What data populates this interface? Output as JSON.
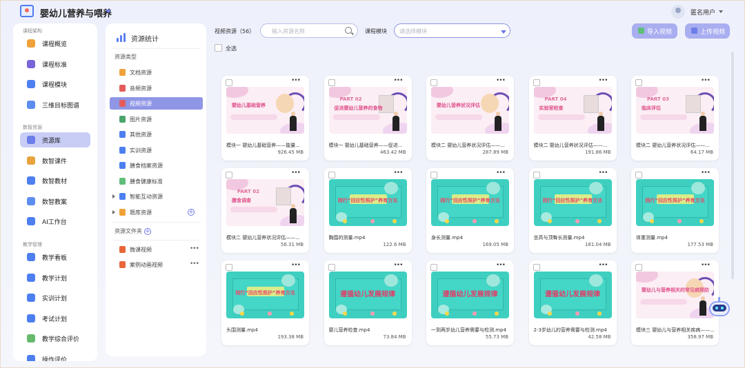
{
  "app": {
    "title": "婴幼儿营养与喂养"
  },
  "user": {
    "name": "匿名用户"
  },
  "nav": {
    "sections": [
      {
        "title": "课程架构",
        "items": [
          "课程概览",
          "课程标准",
          "课程模块",
          "三维目标图谱"
        ]
      },
      {
        "title": "数智资源",
        "items": [
          "资源库",
          "数智课件",
          "数智教材",
          "数智教案",
          "AI工作台"
        ]
      },
      {
        "title": "教学管理",
        "items": [
          "教学看板",
          "教学计划",
          "实训计划",
          "考试计划",
          "教学综合评价",
          "操作评价"
        ]
      }
    ],
    "active": "资源库"
  },
  "resource_panel": {
    "title": "资源统计",
    "type_label": "资源类型",
    "types": [
      "文档资源",
      "音频资源",
      "视频资源",
      "图片资源",
      "其他资源",
      "实训资源",
      "膳食档案资源",
      "膳食健康标准",
      "智能互动资源",
      "题库资源"
    ],
    "active": "视频资源",
    "folder_label": "资源文件夹",
    "folders": [
      "微课视频",
      "案例动画视频"
    ]
  },
  "toolbar": {
    "video_label": "视频资源（56）",
    "search_placeholder": "输入资源名称",
    "module_label": "课程模块",
    "module_placeholder": "请选择模块",
    "import_button": "导入视频",
    "upload_button": "上传视频",
    "select_all": "全选"
  },
  "videos": [
    {
      "name": "模块一 婴幼儿基础营养——能量...",
      "size": "926.45 MB",
      "thumb": "pink",
      "title": "婴幼儿基础营养",
      "part": ""
    },
    {
      "name": "模块一 婴幼儿基础营养——促进...",
      "size": "463.42 MB",
      "thumb": "pink",
      "title": "促进婴幼儿营养的食物",
      "part": "PART 02"
    },
    {
      "name": "模块二 婴幼儿营养状况评估——...",
      "size": "287.89 MB",
      "thumb": "pink",
      "title": "婴幼儿营养状况评估",
      "part": ""
    },
    {
      "name": "模块二 婴幼儿营养状况评估——...",
      "size": "191.86 MB",
      "thumb": "pink",
      "title": "实验室检查",
      "part": "PART 04"
    },
    {
      "name": "模块二 婴幼儿营养状况评估——...",
      "size": "64.17 MB",
      "thumb": "pink",
      "title": "临床评估",
      "part": "PART 03"
    },
    {
      "name": "模块二 婴幼儿营养状况评估——...",
      "size": "56.31 MB",
      "thumb": "pink",
      "title": "膳食调查",
      "part": "PART 02"
    },
    {
      "name": "胸围的测量.mp4",
      "size": "122.6 MB",
      "thumb": "teal",
      "title": "践行“回应性照护”养育方法"
    },
    {
      "name": "身长测量.mp4",
      "size": "169.05 MB",
      "thumb": "teal",
      "title": "践行“回应性照护”养育方法"
    },
    {
      "name": "坐高与顶臀长测量.mp4",
      "size": "181.04 MB",
      "thumb": "teal",
      "title": "践行“回应性照护”养育方法"
    },
    {
      "name": "体重测量.mp4",
      "size": "177.53 MB",
      "thumb": "teal",
      "title": "践行“回应性照护”养育方法"
    },
    {
      "name": "头围测量.mp4",
      "size": "193.38 MB",
      "thumb": "teal",
      "title": "践行“回应性照护”养育方法"
    },
    {
      "name": "婴儿营养检查.mp4",
      "size": "73.84 MB",
      "thumb": "teal",
      "title": "遵循幼儿发展规律",
      "big": true
    },
    {
      "name": "一到两岁幼儿营养需要与检测.mp4",
      "size": "55.73 MB",
      "thumb": "teal",
      "title": "遵循幼儿发展规律",
      "big": true
    },
    {
      "name": "2-3岁幼儿的营养需要与检测.mp4",
      "size": "42.58 MB",
      "thumb": "teal",
      "title": "遵循幼儿发展规律",
      "big": true
    },
    {
      "name": "模块三 婴幼儿与营养相关疾病——...",
      "size": "358.97 MB",
      "thumb": "pink",
      "title": "婴幼儿与营养相关的常见病预防",
      "part": ""
    }
  ],
  "colors": {
    "accent": "#6b78e8",
    "active_nav": "#c8cdf6",
    "active_type": "#8f96e6",
    "button": "#a9aef0"
  }
}
